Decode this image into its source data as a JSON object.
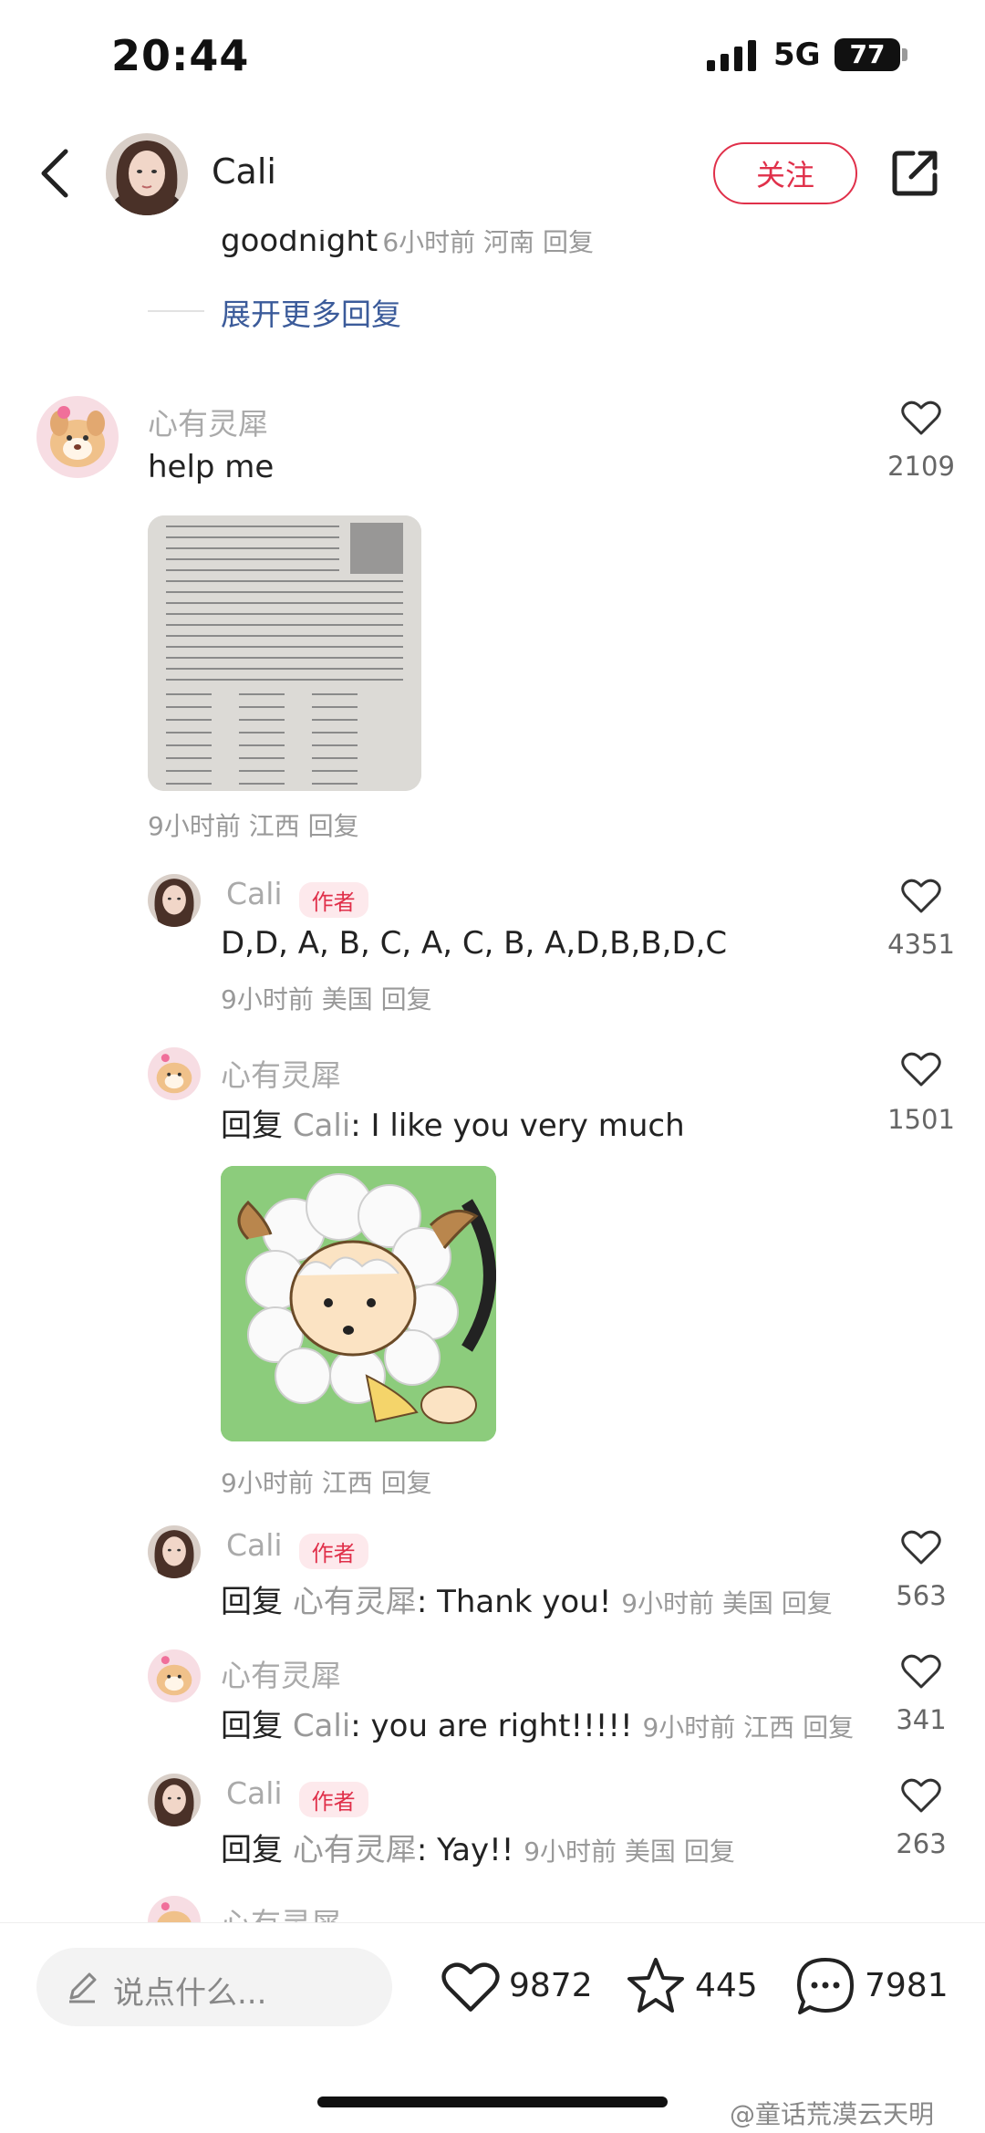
{
  "status_bar": {
    "time": "20:44",
    "network": "5G",
    "battery": "77"
  },
  "header": {
    "name": "Cali",
    "follow_label": "关注"
  },
  "thread": {
    "prev_reply_text": "goodnight",
    "prev_reply_meta": "6小时前 河南 回复",
    "expand_more": "展开更多回复"
  },
  "main_comment": {
    "user": "心有灵犀",
    "text": "help  me",
    "likes": "2109",
    "meta": "9小时前 江西 回复"
  },
  "replies": [
    {
      "user": "Cali",
      "badge": "作者",
      "text": "D,D, A, B, C, A, C, B, A,D,B,B,D,C",
      "likes": "4351",
      "meta": "9小时前 美国 回复"
    },
    {
      "user": "心有灵犀",
      "reply_prefix": "回复",
      "reply_to": "Cali",
      "text": ": I  like you very much",
      "likes": "1501",
      "meta": "9小时前 江西 回复"
    },
    {
      "user": "Cali",
      "badge": "作者",
      "reply_prefix": "回复",
      "reply_to": "心有灵犀",
      "text": ": Thank you!",
      "meta": "9小时前 美国 回复",
      "likes": "563"
    },
    {
      "user": "心有灵犀",
      "reply_prefix": "回复",
      "reply_to": "Cali",
      "text": ": you are  right!!!!!",
      "meta": "9小时前 江西 回复",
      "likes": "341"
    },
    {
      "user": "Cali",
      "badge": "作者",
      "reply_prefix": "回复",
      "reply_to": "心有灵犀",
      "text": ": Yay!!",
      "meta": "9小时前 美国 回复",
      "likes": "263"
    },
    {
      "user": "心有灵犀"
    }
  ],
  "bottom_bar": {
    "input_placeholder": "说点什么...",
    "likes": "9872",
    "stars": "445",
    "comments": "7981"
  },
  "watermark": "@童话荒漠云天明",
  "icons": [
    "back-arrow-icon",
    "share-icon",
    "heart-icon",
    "star-icon",
    "comment-icon",
    "pencil-icon",
    "signal-icon"
  ],
  "colors": {
    "accent": "#e0304a",
    "badge_bg": "#fde9ec",
    "meta": "#999999"
  }
}
